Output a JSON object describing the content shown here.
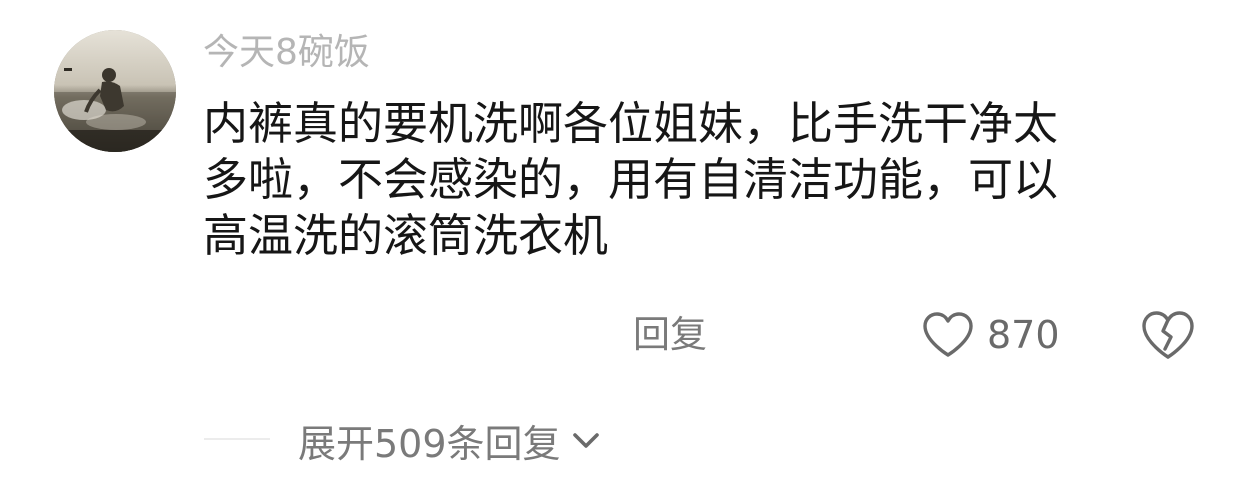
{
  "comment": {
    "username": "今天8碗饭",
    "avatar_icon": "avatar-photo-person-by-water",
    "text_lines": [
      "内裤真的要机洗啊各位姐妹，比手洗干净太",
      "多啦，不会感染的，用有自清洁功能，可以",
      "高温洗的滚筒洗衣机"
    ],
    "reply_label": "回复",
    "like_icon": "heart-outline-icon",
    "like_count": "870",
    "dislike_icon": "broken-heart-icon"
  },
  "replies": {
    "expand_label": "展开509条回复",
    "expand_icon": "chevron-down-icon"
  },
  "colors": {
    "username": "#b5b5b5",
    "text": "#161616",
    "secondary": "#7a7a7a",
    "divider": "#ececec"
  }
}
